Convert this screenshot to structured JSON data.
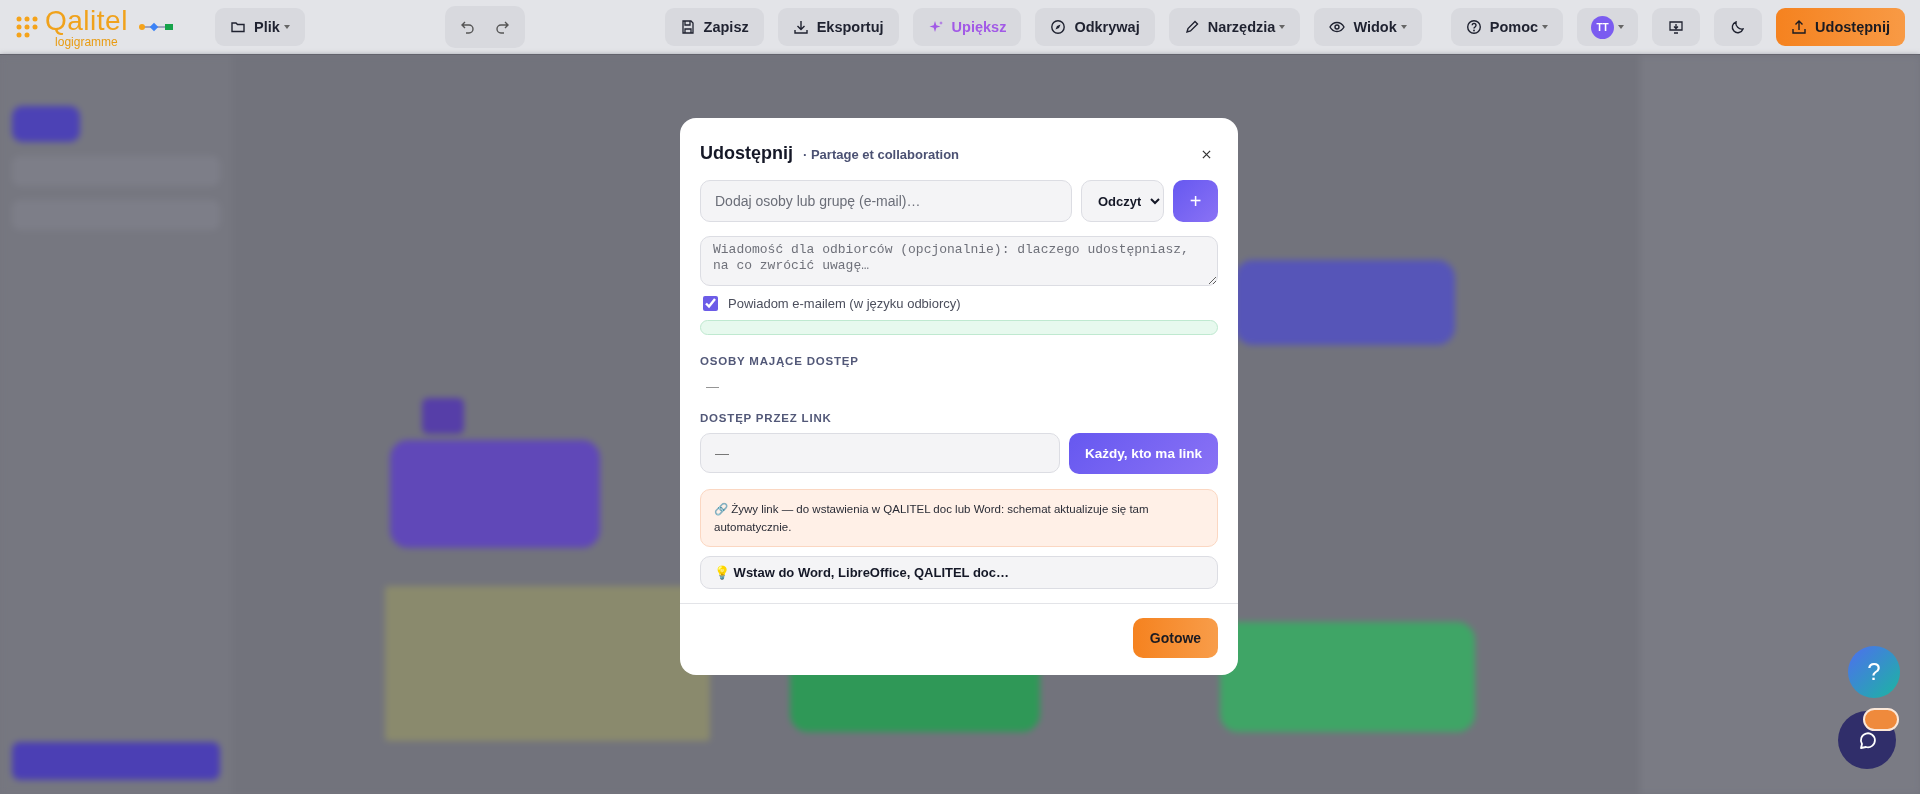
{
  "logo": {
    "name": "Qalitel",
    "subtitle": "logigramme"
  },
  "toolbar": {
    "file": {
      "label": "Plik",
      "kind": "folder",
      "dropdown": true
    },
    "history": [
      {
        "kind": "undo"
      },
      {
        "kind": "redo"
      }
    ],
    "main": [
      {
        "label": "Zapisz",
        "kind": "save",
        "dropdown": false
      },
      {
        "label": "Eksportuj",
        "kind": "download",
        "dropdown": false
      },
      {
        "label": "Upiększ",
        "kind": "sparkle",
        "dropdown": false
      },
      {
        "label": "Odkrywaj",
        "kind": "compass",
        "dropdown": false
      },
      {
        "label": "Narzędzia",
        "kind": "pencil",
        "dropdown": true
      },
      {
        "label": "Widok",
        "kind": "eye",
        "dropdown": true
      }
    ],
    "right": [
      {
        "label": "Pomoc",
        "kind": "help",
        "dropdown": true
      },
      {
        "label": "TT",
        "kind": "avatar",
        "dropdown": true
      },
      {
        "kind": "screen",
        "dropdown": false
      },
      {
        "kind": "moon",
        "dropdown": false
      },
      {
        "label": "Udostępnij",
        "kind": "share",
        "dropdown": false
      }
    ]
  },
  "share_dialog": {
    "title": "Udostępnij",
    "subtitle": "· Partage et collaboration",
    "invite": {
      "placeholder": "Dodaj osoby lub grupę (e-mail)…",
      "role": "Odczyt",
      "add_button": "+"
    },
    "message": {
      "placeholder": "Wiadomość dla odbiorców (opcjonalnie): dlaczego udostępniasz, na co zwrócić uwagę…"
    },
    "notify": {
      "label": "Powiadom e-mailem (w języku odbiorcy)",
      "checked": true
    },
    "people": {
      "heading": "OSOBY MAJĄCE DOSTĘP",
      "empty": "—"
    },
    "link": {
      "heading": "DOSTĘP PRZEZ LINK",
      "value": "—",
      "access_button": "Każdy, kto ma link"
    },
    "live_link_note": "🔗 Żywy link — do wstawienia w QALITEL doc lub Word: schemat aktualizuje się tam automatycznie.",
    "insert_tip": "💡 Wstaw do Word, LibreOffice, QALITEL doc…",
    "done_button": "Gotowe"
  },
  "help_button": "?"
}
